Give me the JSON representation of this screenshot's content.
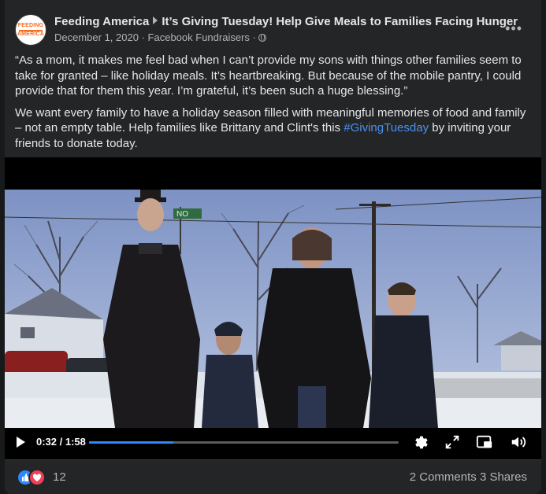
{
  "post": {
    "page_name": "Feeding America",
    "post_title": "It’s Giving Tuesday! Help Give Meals to Families Facing Hunger",
    "date": "December 1, 2020",
    "source": "Facebook Fundraisers",
    "separator": "·",
    "more_label": "•••",
    "avatar": {
      "line1": "FEEDING",
      "line2": "AMERICA"
    },
    "paragraph1": "“As a mom, it makes me feel bad when I can’t provide my sons with things other families seem to take for granted – like holiday meals. It’s heartbreaking. But because of the mobile pantry, I could provide that for them this year. I’m grateful, it’s been such a huge blessing.”",
    "paragraph2_before": "We want every family to have a holiday season filled with meaningful memories of food and family – not an empty table. Help families like Brittany and Clint's this ",
    "hashtag": "#GivingTuesday",
    "paragraph2_after": " by inviting your friends to donate today."
  },
  "video": {
    "current_time": "0:32",
    "duration": "1:58",
    "time_separator": " / ",
    "progress": 0.271,
    "icons": [
      "play-icon",
      "settings-gear-icon",
      "fullscreen-icon",
      "picture-in-picture-icon",
      "volume-icon"
    ],
    "street_sign": "NO"
  },
  "footer": {
    "reaction_count": "12",
    "comments": "2 Comments",
    "shares": "3 Shares",
    "reactions": [
      "like-icon",
      "love-icon"
    ]
  },
  "colors": {
    "background": "#18191a",
    "card": "#242526",
    "text": "#e4e6eb",
    "secondary_text": "#b0b3b8",
    "link": "#4a91f0",
    "progress": "#2d88ff",
    "like": "#2d88ff",
    "love": "#f33e58",
    "brand_orange": "#f26c22"
  }
}
